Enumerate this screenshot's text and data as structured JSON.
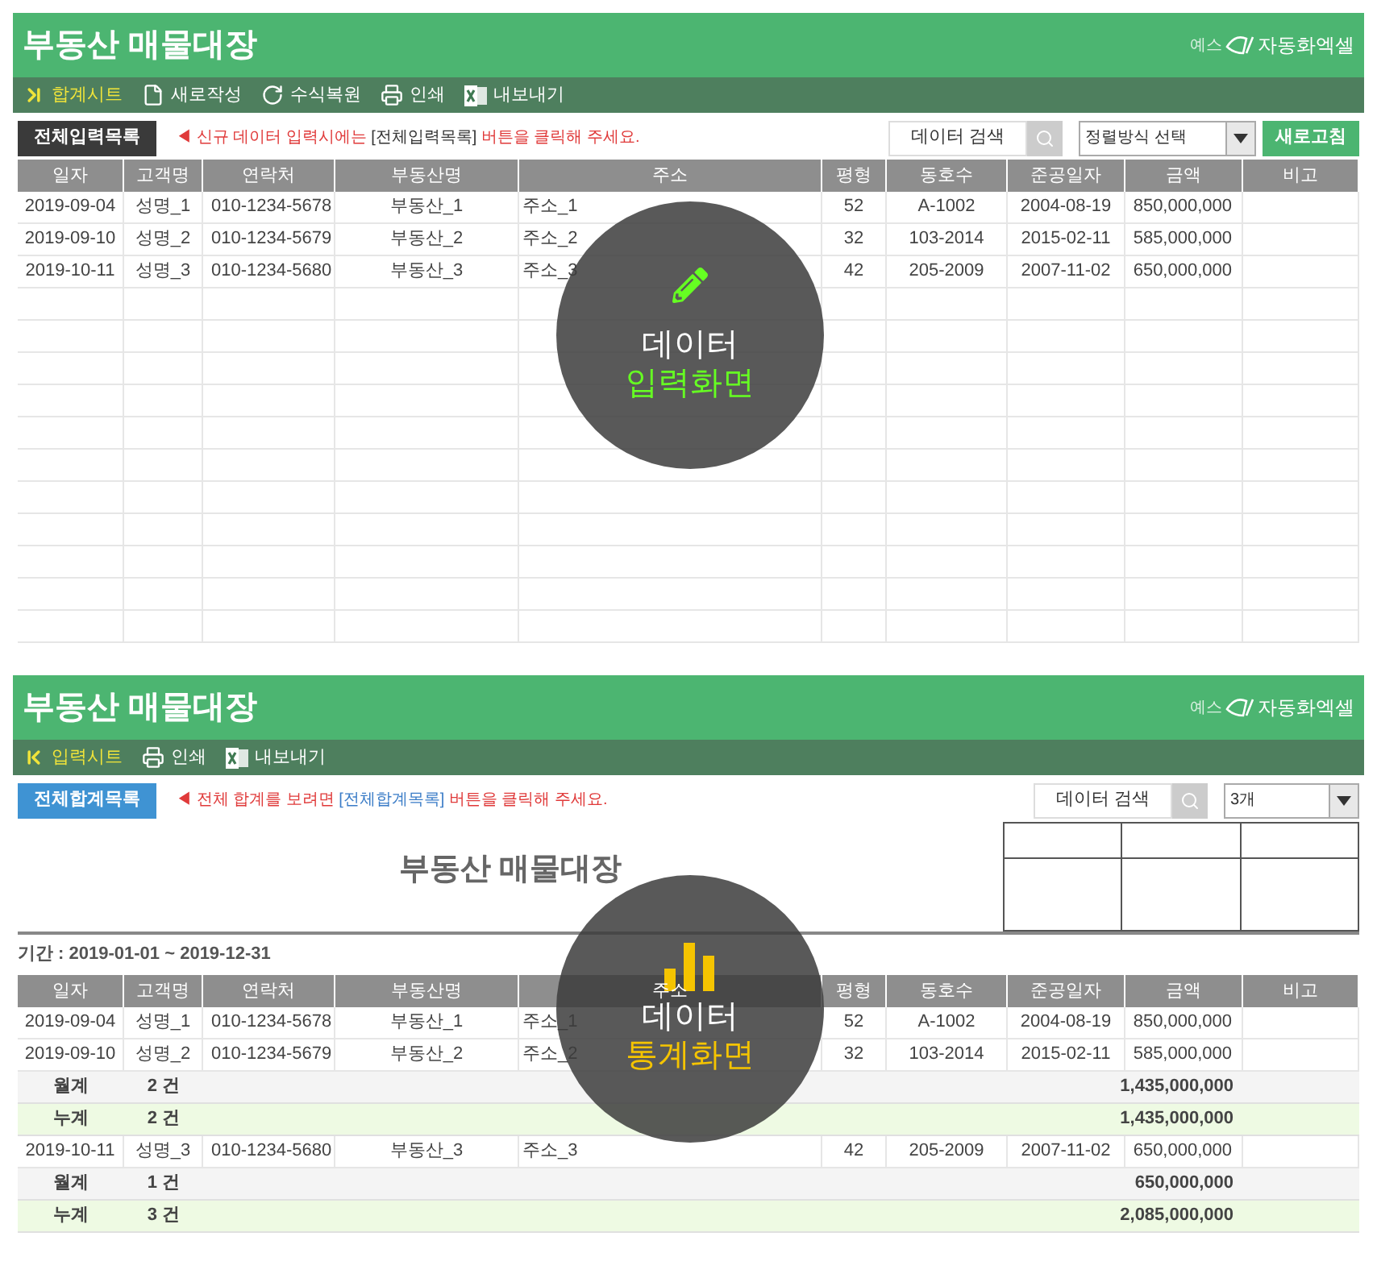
{
  "panels": [
    {
      "kind": "input",
      "title": "부동산 매물대장",
      "brand": {
        "prefix": "예스",
        "name": "자동화엑셀"
      },
      "toolbar": [
        {
          "kind": "next",
          "label": "합계시트",
          "highlighted": true
        },
        {
          "kind": "document",
          "label": "새로작성",
          "highlighted": false
        },
        {
          "kind": "refresh",
          "label": "수식복원",
          "highlighted": false
        },
        {
          "kind": "print",
          "label": "인쇄",
          "highlighted": false
        },
        {
          "kind": "excel",
          "label": "내보내기",
          "highlighted": false
        }
      ],
      "action_button": "전체입력목록",
      "notice": [
        {
          "kind": "alert",
          "text": "◀ 신규 데이터 입력시에는 "
        },
        {
          "kind": "ref",
          "text": "[전체입력목록]"
        },
        {
          "kind": "alert",
          "text": " 버튼을 클릭해 주세요."
        }
      ],
      "search_label": "데이터 검색",
      "select_value": "정렬방식 선택",
      "refresh_button": "새로고침",
      "columns": [
        "일자",
        "고객명",
        "연락처",
        "부동산명",
        "주소",
        "평형",
        "동호수",
        "준공일자",
        "금액",
        "비고"
      ],
      "rows": [
        {
          "kind": "data",
          "cells": [
            "2019-09-04",
            "성명_1",
            "010-1234-5678",
            "부동산_1",
            "주소_1",
            "52",
            "A-1002",
            "2004-08-19",
            "850,000,000"
          ]
        },
        {
          "kind": "data",
          "cells": [
            "2019-09-10",
            "성명_2",
            "010-1234-5679",
            "부동산_2",
            "주소_2",
            "32",
            "103-2014",
            "2015-02-11",
            "585,000,000"
          ]
        },
        {
          "kind": "data",
          "cells": [
            "2019-10-11",
            "성명_3",
            "010-1234-5680",
            "부동산_3",
            "주소_3",
            "42",
            "205-2009",
            "2007-11-02",
            "650,000,000"
          ]
        },
        {
          "kind": "empty"
        },
        {
          "kind": "empty"
        },
        {
          "kind": "empty"
        },
        {
          "kind": "empty"
        },
        {
          "kind": "empty"
        },
        {
          "kind": "empty"
        },
        {
          "kind": "empty"
        },
        {
          "kind": "empty"
        },
        {
          "kind": "empty"
        },
        {
          "kind": "empty"
        },
        {
          "kind": "empty"
        }
      ],
      "overlay": {
        "line1": "데이터",
        "line2": "입력화면"
      }
    },
    {
      "kind": "stats",
      "title": "부동산 매물대장",
      "brand": {
        "prefix": "예스",
        "name": "자동화엑셀"
      },
      "toolbar": [
        {
          "kind": "previous",
          "label": "입력시트",
          "highlighted": true
        },
        {
          "kind": "print",
          "label": "인쇄",
          "highlighted": false
        },
        {
          "kind": "excel",
          "label": "내보내기",
          "highlighted": false
        }
      ],
      "action_button": "전체합계목록",
      "notice": [
        {
          "kind": "alert",
          "text": "◀ 전체 합계를 보려면 "
        },
        {
          "kind": "link",
          "text": "[전체합계목록]"
        },
        {
          "kind": "alert",
          "text": " 버튼을 클릭해 주세요."
        }
      ],
      "search_label": "데이터 검색",
      "select_value": "3개",
      "report_title": "부동산 매물대장",
      "period": "기간 : 2019-01-01 ~ 2019-12-31",
      "columns": [
        "일자",
        "고객명",
        "연락처",
        "부동산명",
        "주소",
        "평형",
        "동호수",
        "준공일자",
        "금액",
        "비고"
      ],
      "rows": [
        {
          "kind": "data",
          "cells": [
            "2019-09-04",
            "성명_1",
            "010-1234-5678",
            "부동산_1",
            "주소_1",
            "52",
            "A-1002",
            "2004-08-19",
            "850,000,000"
          ]
        },
        {
          "kind": "data",
          "cells": [
            "2019-09-10",
            "성명_2",
            "010-1234-5679",
            "부동산_2",
            "주소_2",
            "32",
            "103-2014",
            "2015-02-11",
            "585,000,000"
          ]
        },
        {
          "kind": "month",
          "label": "월계",
          "count": "2 건",
          "amount": "1,435,000,000"
        },
        {
          "kind": "cumulative",
          "label": "누계",
          "count": "2 건",
          "amount": "1,435,000,000"
        },
        {
          "kind": "data",
          "cells": [
            "2019-10-11",
            "성명_3",
            "010-1234-5680",
            "부동산_3",
            "주소_3",
            "42",
            "205-2009",
            "2007-11-02",
            "650,000,000"
          ]
        },
        {
          "kind": "month",
          "label": "월계",
          "count": "1 건",
          "amount": "650,000,000"
        },
        {
          "kind": "cumulative",
          "label": "누계",
          "count": "3 건",
          "amount": "2,085,000,000"
        }
      ],
      "overlay": {
        "line1": "데이터",
        "line2": "통계화면"
      }
    }
  ]
}
